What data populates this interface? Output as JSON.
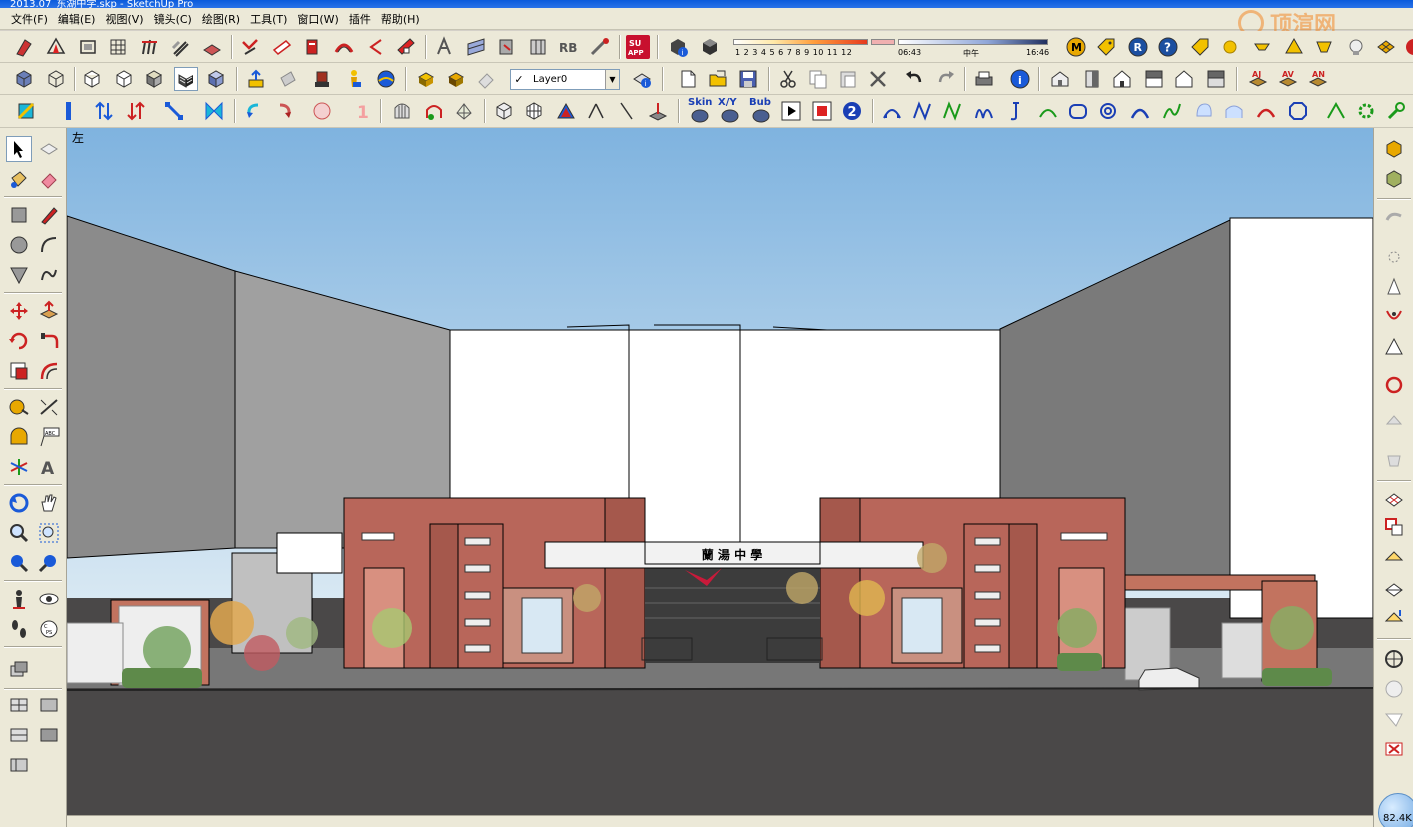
{
  "window": {
    "title": "2013.07_东湖中学.skp - SketchUp Pro"
  },
  "menu": [
    "文件(F)",
    "编辑(E)",
    "视图(V)",
    "镜头(C)",
    "绘图(R)",
    "工具(T)",
    "窗口(W)",
    "插件",
    "帮助(H)"
  ],
  "layer": {
    "current": "Layer0",
    "checked": "✓"
  },
  "shadow": {
    "scale_numbers": "1 2 3 4 5 6 7 8 9 10 11 12",
    "time_start": "06:43",
    "time_mid": "中午",
    "time_end": "16:46"
  },
  "plugins": {
    "skin": "Skin",
    "xy": "X/Y",
    "bub": "Bub",
    "su_app": "SU APP"
  },
  "viewport": {
    "view_label": "左",
    "sign_text": "蘭 湯 中 學"
  },
  "watermark": {
    "text": "顶渲网"
  },
  "status": {
    "size": "82.4K"
  },
  "colors": {
    "ui_bg": "#ece9d8",
    "sky_top": "#7fb3df",
    "sky_bottom": "#d8e8f3",
    "wall_red": "#b8665a",
    "ground": "#4a4848"
  }
}
